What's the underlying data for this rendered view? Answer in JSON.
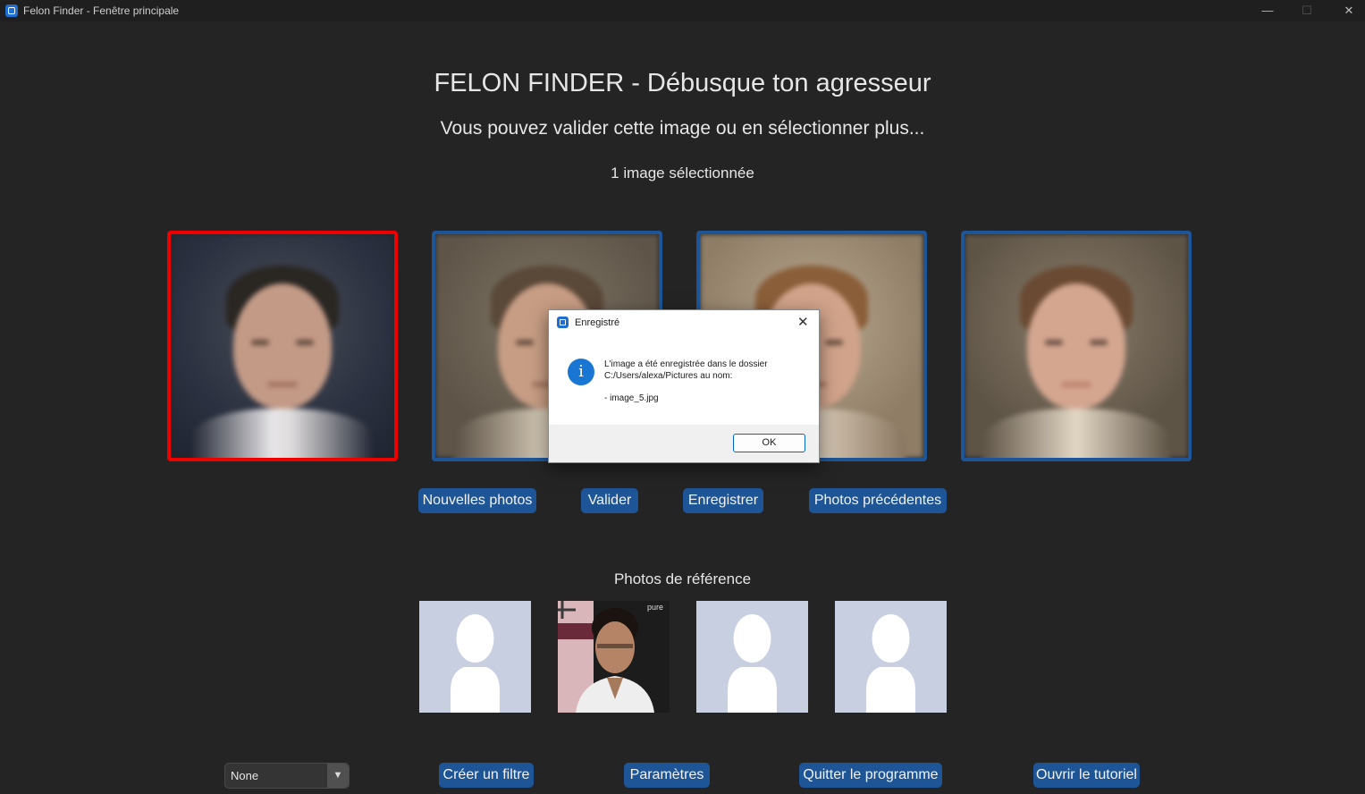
{
  "window": {
    "title": "Felon Finder - Fenêtre principale",
    "minimize": "—",
    "maximize": "☐",
    "close": "✕"
  },
  "header": {
    "title": "FELON FINDER - Débusque ton agresseur",
    "subtitle": "Vous pouvez valider cette image ou en sélectionner plus...",
    "selection_count": "1 image sélectionnée"
  },
  "candidates": [
    {
      "selected": true
    },
    {
      "selected": false
    },
    {
      "selected": false
    },
    {
      "selected": false
    }
  ],
  "actions": {
    "new_photos": "Nouvelles photos",
    "validate": "Valider",
    "save": "Enregistrer",
    "previous_photos": "Photos précédentes"
  },
  "reference": {
    "label": "Photos de référence",
    "photos": [
      "placeholder",
      "portrait",
      "placeholder",
      "placeholder"
    ],
    "portrait_text": "pure"
  },
  "bottom": {
    "filter_select_value": "None",
    "create_filter": "Créer un filtre",
    "settings": "Paramètres",
    "quit": "Quitter le programme",
    "tutorial": "Ouvrir le tutoriel"
  },
  "dialog": {
    "title": "Enregistré",
    "close": "✕",
    "message_line1": "L'image a été enregistrée dans le dossier",
    "message_line2": "C:/Users/alexa/Pictures au nom:",
    "filename": "- image_5.jpg",
    "ok": "OK",
    "icon": "info-icon"
  },
  "colors": {
    "background": "#242424",
    "accent": "#1e5596",
    "selected_border": "#ee0000"
  }
}
